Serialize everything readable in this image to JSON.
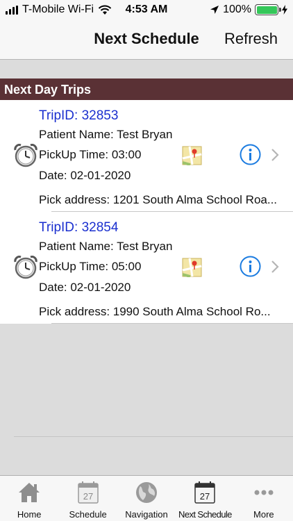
{
  "status_bar": {
    "carrier": "T-Mobile Wi-Fi",
    "time": "4:53 AM",
    "battery": "100%",
    "battery_level": 1.0
  },
  "nav": {
    "title": "Next Schedule",
    "refresh_label": "Refresh"
  },
  "section": {
    "title": "Next Day Trips"
  },
  "trips": [
    {
      "trip_id": "TripID: 32853",
      "patient": "Patient Name: Test Bryan",
      "pickup_time": "PickUp Time: 03:00",
      "date": "Date: 02-01-2020",
      "address": "Pick address: 1201 South Alma School Roa..."
    },
    {
      "trip_id": "TripID: 32854",
      "patient": "Patient Name: Test Bryan",
      "pickup_time": "PickUp Time: 05:00",
      "date": "Date: 02-01-2020",
      "address": "Pick address: 1990 South Alma School Ro..."
    }
  ],
  "tabs": [
    {
      "label": "Home",
      "icon": "home-icon"
    },
    {
      "label": "Schedule",
      "icon": "calendar-icon",
      "badge": "27"
    },
    {
      "label": "Navigation",
      "icon": "globe-icon"
    },
    {
      "label": "Next Schedule",
      "icon": "calendar-icon",
      "badge": "27",
      "active": true
    },
    {
      "label": "More",
      "icon": "more-icon"
    }
  ],
  "colors": {
    "section_header": "#5a3135",
    "trip_id": "#1a2fcf",
    "info_blue": "#1a7be0",
    "battery_green": "#34c759"
  }
}
